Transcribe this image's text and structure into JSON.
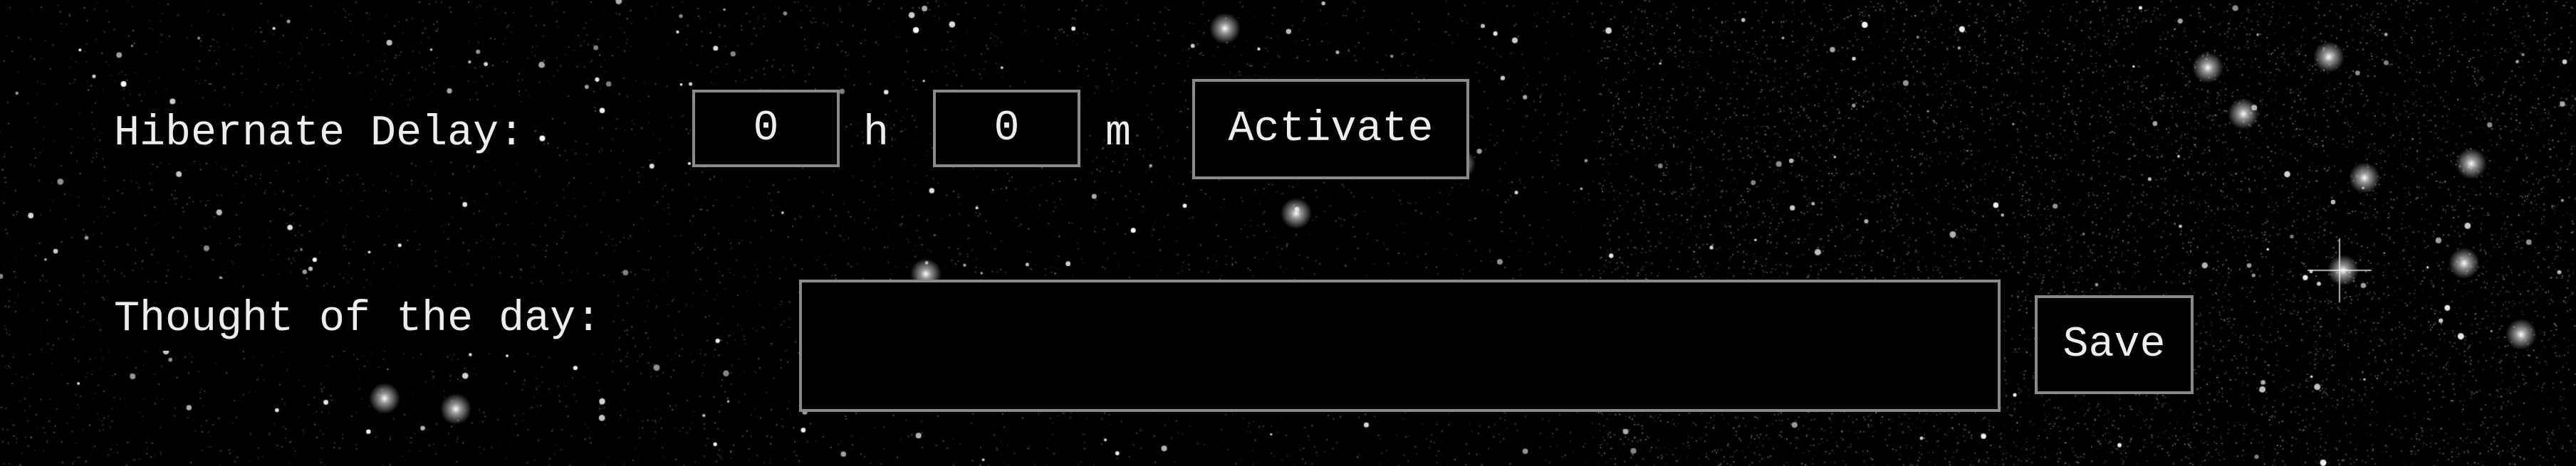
{
  "hibernate": {
    "label": "Hibernate Delay:",
    "hours_value": "0",
    "hours_unit": "h",
    "minutes_value": "0",
    "minutes_unit": "m",
    "activate_label": "Activate"
  },
  "thought": {
    "label": "Thought of the day:",
    "value": "",
    "save_label": "Save"
  },
  "colors": {
    "background": "#000000",
    "text": "#ededed",
    "border": "#8a8a8a",
    "stars": "#ffffff"
  }
}
